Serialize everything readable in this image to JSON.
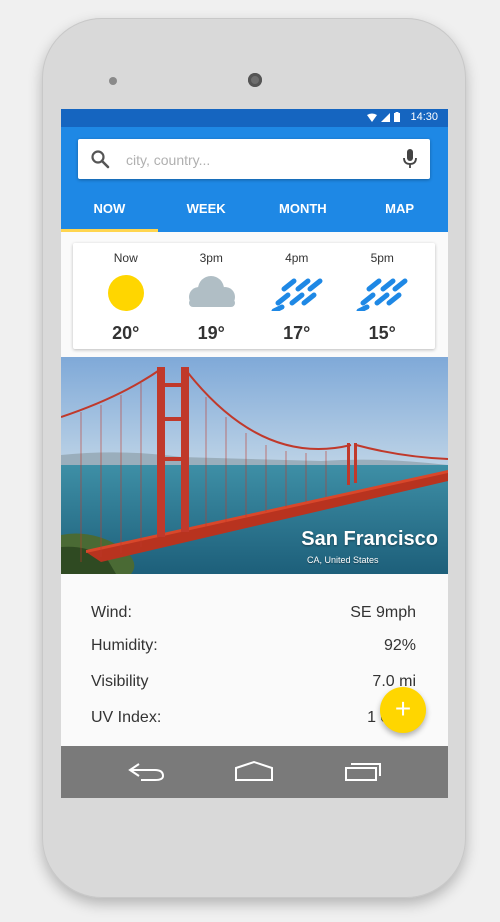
{
  "status_bar": {
    "time": "14:30",
    "icons": [
      "wifi-icon",
      "signal-icon",
      "battery-icon"
    ]
  },
  "search": {
    "placeholder": "city, country...",
    "value": ""
  },
  "tabs": [
    {
      "label": "NOW",
      "active": true
    },
    {
      "label": "WEEK",
      "active": false
    },
    {
      "label": "MONTH",
      "active": false
    },
    {
      "label": "MAP",
      "active": false
    }
  ],
  "forecast": [
    {
      "time": "Now",
      "icon": "sun-icon",
      "temp": "20°"
    },
    {
      "time": "3pm",
      "icon": "cloud-icon",
      "temp": "19°"
    },
    {
      "time": "4pm",
      "icon": "rain-icon",
      "temp": "17°"
    },
    {
      "time": "5pm",
      "icon": "rain-icon",
      "temp": "15°"
    }
  ],
  "location": {
    "city": "San Francisco",
    "region": "CA, United States"
  },
  "details": [
    {
      "label": "Wind:",
      "value": "SE 9mph"
    },
    {
      "label": "Humidity:",
      "value": "92%"
    },
    {
      "label": "Visibility",
      "value": "7.0 mi"
    },
    {
      "label": "UV Index:",
      "value": "1 of 10"
    }
  ],
  "fab": {
    "label": "+",
    "icon": "add-icon"
  },
  "nav_icons": [
    "back-icon",
    "home-icon",
    "recents-icon"
  ],
  "colors": {
    "status_bar": "#1565c0",
    "app_bar": "#1e88e5",
    "tab_indicator": "#ffd54f",
    "sun": "#ffd600",
    "cloud": "#b0bec5",
    "rain": "#1e88e5",
    "fab": "#ffd600",
    "nav_bar": "#7a7a7a"
  }
}
